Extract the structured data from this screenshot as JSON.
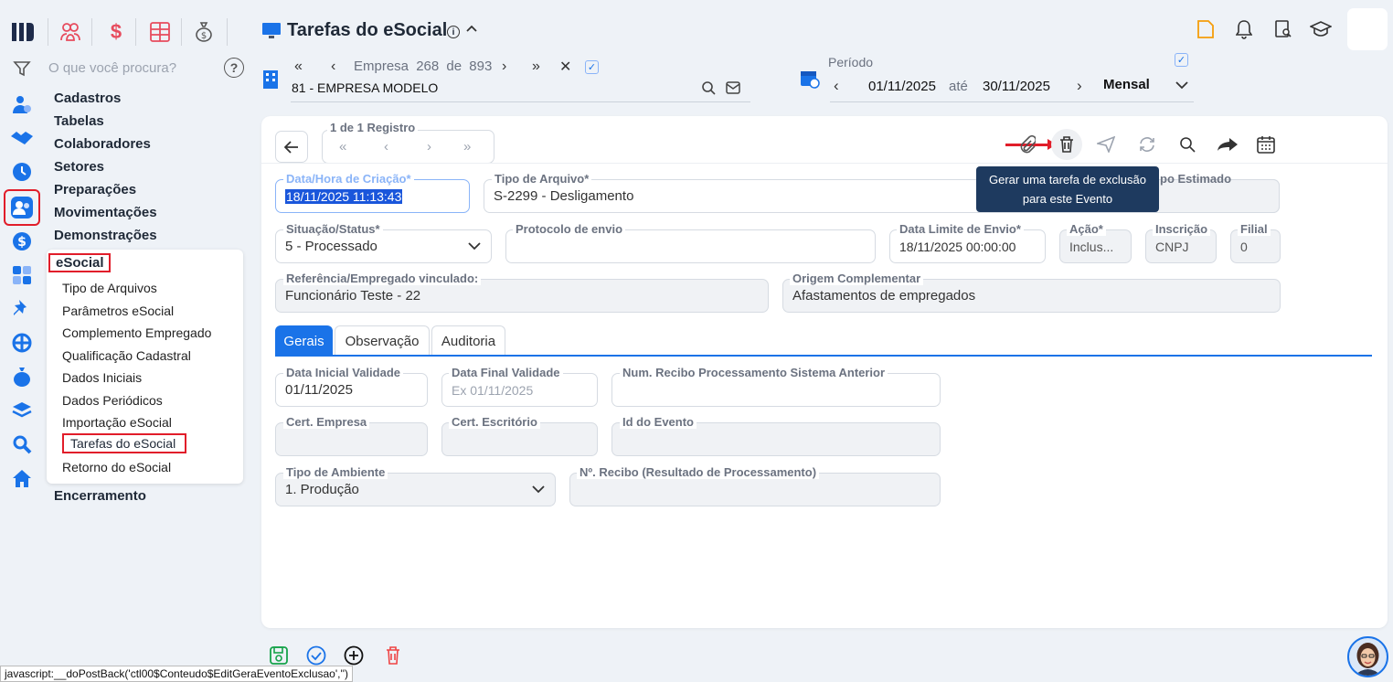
{
  "search": {
    "placeholder": "O que você procura?"
  },
  "menu": {
    "main": [
      "Cadastros",
      "Tabelas",
      "Colaboradores",
      "Setores",
      "Preparações",
      "Movimentações",
      "Demonstrações"
    ],
    "esocial_title": "eSocial",
    "sub": [
      "Tipo de Arquivos",
      "Parâmetros eSocial",
      "Complemento Empregado",
      "Qualificação Cadastral",
      "Dados Iniciais",
      "Dados Periódicos",
      "Importação eSocial",
      "Tarefas do eSocial",
      "Retorno do eSocial"
    ],
    "after": "Encerramento"
  },
  "header": {
    "title": "Tarefas do eSocial",
    "empresa_label": "Empresa",
    "empresa_index": "268",
    "empresa_de": "de",
    "empresa_total": "893",
    "empresa_name": "81 - EMPRESA MODELO",
    "periodo_label": "Período",
    "periodo_start": "01/11/2025",
    "periodo_ate": "até",
    "periodo_end": "30/11/2025",
    "periodo_type": "Mensal"
  },
  "record_nav": {
    "label": "1 de 1 Registro"
  },
  "tooltip": {
    "line1": "Gerar uma tarefa de exclusão",
    "line2": "para este Evento"
  },
  "form": {
    "data_hora": {
      "label": "Data/Hora de Criação*",
      "value": "18/11/2025 11:13:43"
    },
    "tipo_arquivo": {
      "label": "Tipo de Arquivo*",
      "value": "S-2299 - Desligamento"
    },
    "tempo_estimado": {
      "label": "po Estimado"
    },
    "situacao": {
      "label": "Situação/Status*",
      "value": "5 - Processado"
    },
    "protocolo": {
      "label": "Protocolo de envio",
      "value": ""
    },
    "data_limite": {
      "label": "Data Limite de Envio*",
      "value": "18/11/2025 00:00:00"
    },
    "acao": {
      "label": "Ação*",
      "value": "Inclus..."
    },
    "inscricao": {
      "label": "Inscrição",
      "value": "CNPJ"
    },
    "filial": {
      "label": "Filial",
      "value": "0"
    },
    "referencia": {
      "label": "Referência/Empregado vinculado:",
      "value": "Funcionário Teste - 22"
    },
    "origem": {
      "label": "Origem Complementar",
      "value": "Afastamentos de empregados"
    }
  },
  "tabs": [
    "Gerais",
    "Observação",
    "Auditoria"
  ],
  "gerais": {
    "data_inicial": {
      "label": "Data Inicial Validade",
      "value": "01/11/2025"
    },
    "data_final": {
      "label": "Data Final Validade",
      "placeholder": "Ex 01/11/2025"
    },
    "num_recibo": {
      "label": "Num. Recibo Processamento Sistema Anterior",
      "value": ""
    },
    "cert_empresa": {
      "label": "Cert. Empresa",
      "value": ""
    },
    "cert_escritorio": {
      "label": "Cert. Escritório",
      "value": ""
    },
    "id_evento": {
      "label": "Id do Evento",
      "value": ""
    },
    "tipo_ambiente": {
      "label": "Tipo de Ambiente",
      "value": "1. Produção"
    },
    "num_recibo_res": {
      "label": "Nº. Recibo (Resultado de Processamento)",
      "value": ""
    }
  },
  "statusbar": "javascript:__doPostBack('ctl00$Conteudo$EditGeraEventoExclusao','')",
  "colors": {
    "accent": "#1a73e8",
    "highlight": "#e11d2a",
    "tooltip": "#1e3a5f"
  }
}
